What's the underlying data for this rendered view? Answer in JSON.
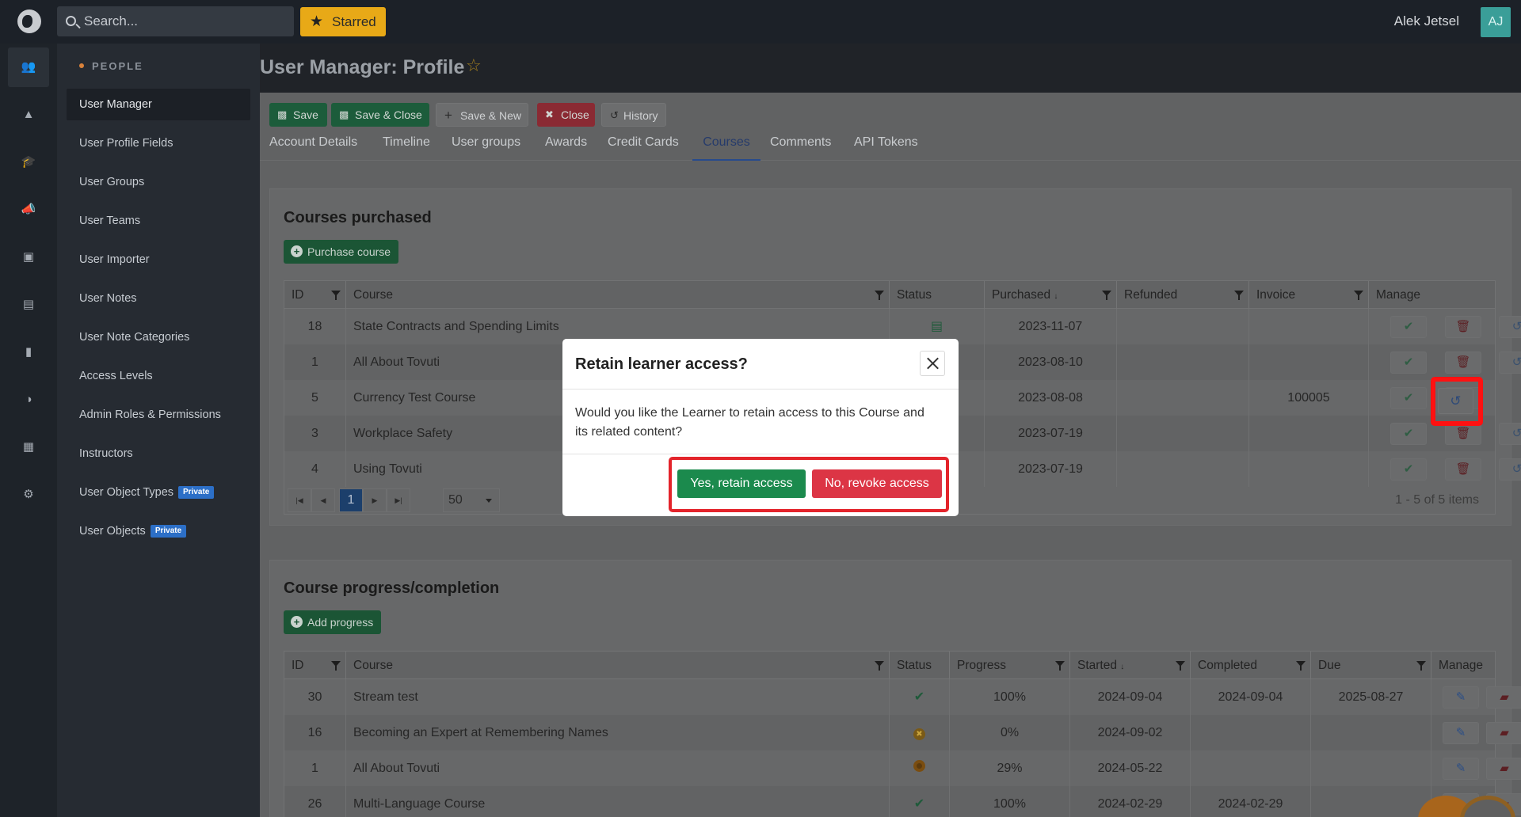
{
  "topbar": {
    "search_placeholder": "Search...",
    "starred_label": "Starred",
    "user_name": "Alek Jetsel",
    "avatar_initials": "AJ"
  },
  "rail": {
    "icons": [
      "users-icon",
      "shapes-icon",
      "graduation-cap-icon",
      "megaphone-icon",
      "money-icon",
      "chart-icon",
      "chat-icon",
      "palette-icon",
      "calendar-icon",
      "gear-icon"
    ]
  },
  "nav": {
    "section": "PEOPLE",
    "items": [
      {
        "label": "User Manager"
      },
      {
        "label": "User Profile Fields"
      },
      {
        "label": "User Groups"
      },
      {
        "label": "User Teams"
      },
      {
        "label": "User Importer"
      },
      {
        "label": "User Notes"
      },
      {
        "label": "User Note Categories"
      },
      {
        "label": "Access Levels"
      },
      {
        "label": "Admin Roles & Permissions"
      },
      {
        "label": "Instructors"
      },
      {
        "label": "User Object Types",
        "badge": "Private"
      },
      {
        "label": "User Objects",
        "badge": "Private"
      }
    ]
  },
  "page": {
    "title": "User Manager: Profile",
    "toolbar": {
      "save": "Save",
      "save_close": "Save & Close",
      "save_new": "Save & New",
      "close": "Close",
      "history": "History"
    },
    "tabs": [
      "Account Details",
      "Timeline",
      "User groups",
      "Awards",
      "Credit Cards",
      "Courses",
      "Comments",
      "API Tokens"
    ],
    "active_tab": "Courses"
  },
  "purchased": {
    "heading": "Courses purchased",
    "add_label": "Purchase course",
    "columns": [
      "ID",
      "Course",
      "Status",
      "Purchased",
      "Refunded",
      "Invoice",
      "Manage"
    ],
    "rows": [
      {
        "id": "18",
        "course": "State Contracts and Spending Limits",
        "purchased": "2023-11-07",
        "refunded": "",
        "invoice": ""
      },
      {
        "id": "1",
        "course": "All About Tovuti",
        "purchased": "2023-08-10",
        "refunded": "",
        "invoice": ""
      },
      {
        "id": "5",
        "course": "Currency Test Course",
        "purchased": "2023-08-08",
        "refunded": "",
        "invoice": "100005"
      },
      {
        "id": "3",
        "course": "Workplace Safety",
        "purchased": "2023-07-19",
        "refunded": "",
        "invoice": ""
      },
      {
        "id": "4",
        "course": "Using Tovuti",
        "purchased": "2023-07-19",
        "refunded": "",
        "invoice": ""
      }
    ],
    "pager": {
      "page": "1",
      "page_size": "50",
      "info": "1 - 5 of 5 items"
    }
  },
  "progress": {
    "heading": "Course progress/completion",
    "add_label": "Add progress",
    "columns": [
      "ID",
      "Course",
      "Status",
      "Progress",
      "Started",
      "Completed",
      "Due",
      "Manage"
    ],
    "rows": [
      {
        "id": "30",
        "course": "Stream test",
        "status": "complete",
        "progress": "100%",
        "started": "2024-09-04",
        "completed": "2024-09-04",
        "due": "2025-08-27"
      },
      {
        "id": "16",
        "course": "Becoming an Expert at Remembering Names",
        "status": "failed",
        "progress": "0%",
        "started": "2024-09-02",
        "completed": "",
        "due": ""
      },
      {
        "id": "1",
        "course": "All About Tovuti",
        "status": "in-progress",
        "progress": "29%",
        "started": "2024-05-22",
        "completed": "",
        "due": ""
      },
      {
        "id": "26",
        "course": "Multi-Language Course",
        "status": "complete",
        "progress": "100%",
        "started": "2024-02-29",
        "completed": "2024-02-29",
        "due": ""
      }
    ]
  },
  "modal": {
    "title": "Retain learner access?",
    "body": "Would you like the Learner to retain access to this Course and its related content?",
    "yes_label": "Yes, retain access",
    "no_label": "No, revoke access"
  },
  "colors": {
    "accent_green": "#1b8a4d",
    "danger_red": "#dc3545",
    "annotation_red": "#ff1111",
    "active_tab_blue": "#274b8d"
  }
}
